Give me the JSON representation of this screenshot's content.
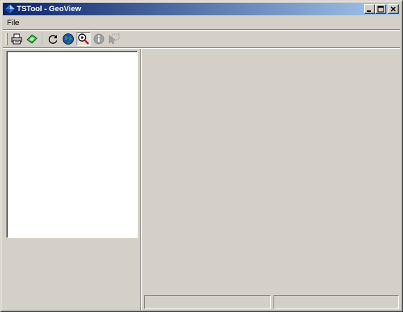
{
  "window": {
    "title": "TSTool - GeoView",
    "title_icon": "diamond-app-icon",
    "controls": [
      "minimize-icon",
      "maximize-icon",
      "close-icon"
    ]
  },
  "menu": {
    "items": [
      {
        "label": "File"
      }
    ]
  },
  "toolbar": {
    "tools": [
      {
        "icon": "printer-icon",
        "enabled": true,
        "pressed": false
      },
      {
        "icon": "save-image-icon",
        "enabled": true,
        "pressed": false
      },
      {
        "icon": "refresh-icon",
        "enabled": true,
        "pressed": false
      },
      {
        "icon": "globe-icon",
        "enabled": true,
        "pressed": false
      },
      {
        "icon": "zoom-icon",
        "enabled": true,
        "pressed": true
      },
      {
        "icon": "info-icon",
        "enabled": false,
        "pressed": false
      },
      {
        "icon": "select-icon",
        "enabled": false,
        "pressed": false
      }
    ]
  },
  "legend": {
    "items": []
  },
  "status": {
    "left": "",
    "right": ""
  },
  "colors": {
    "face": "#d4d0c8",
    "title_start": "#0a246a",
    "title_end": "#a6caf0"
  }
}
